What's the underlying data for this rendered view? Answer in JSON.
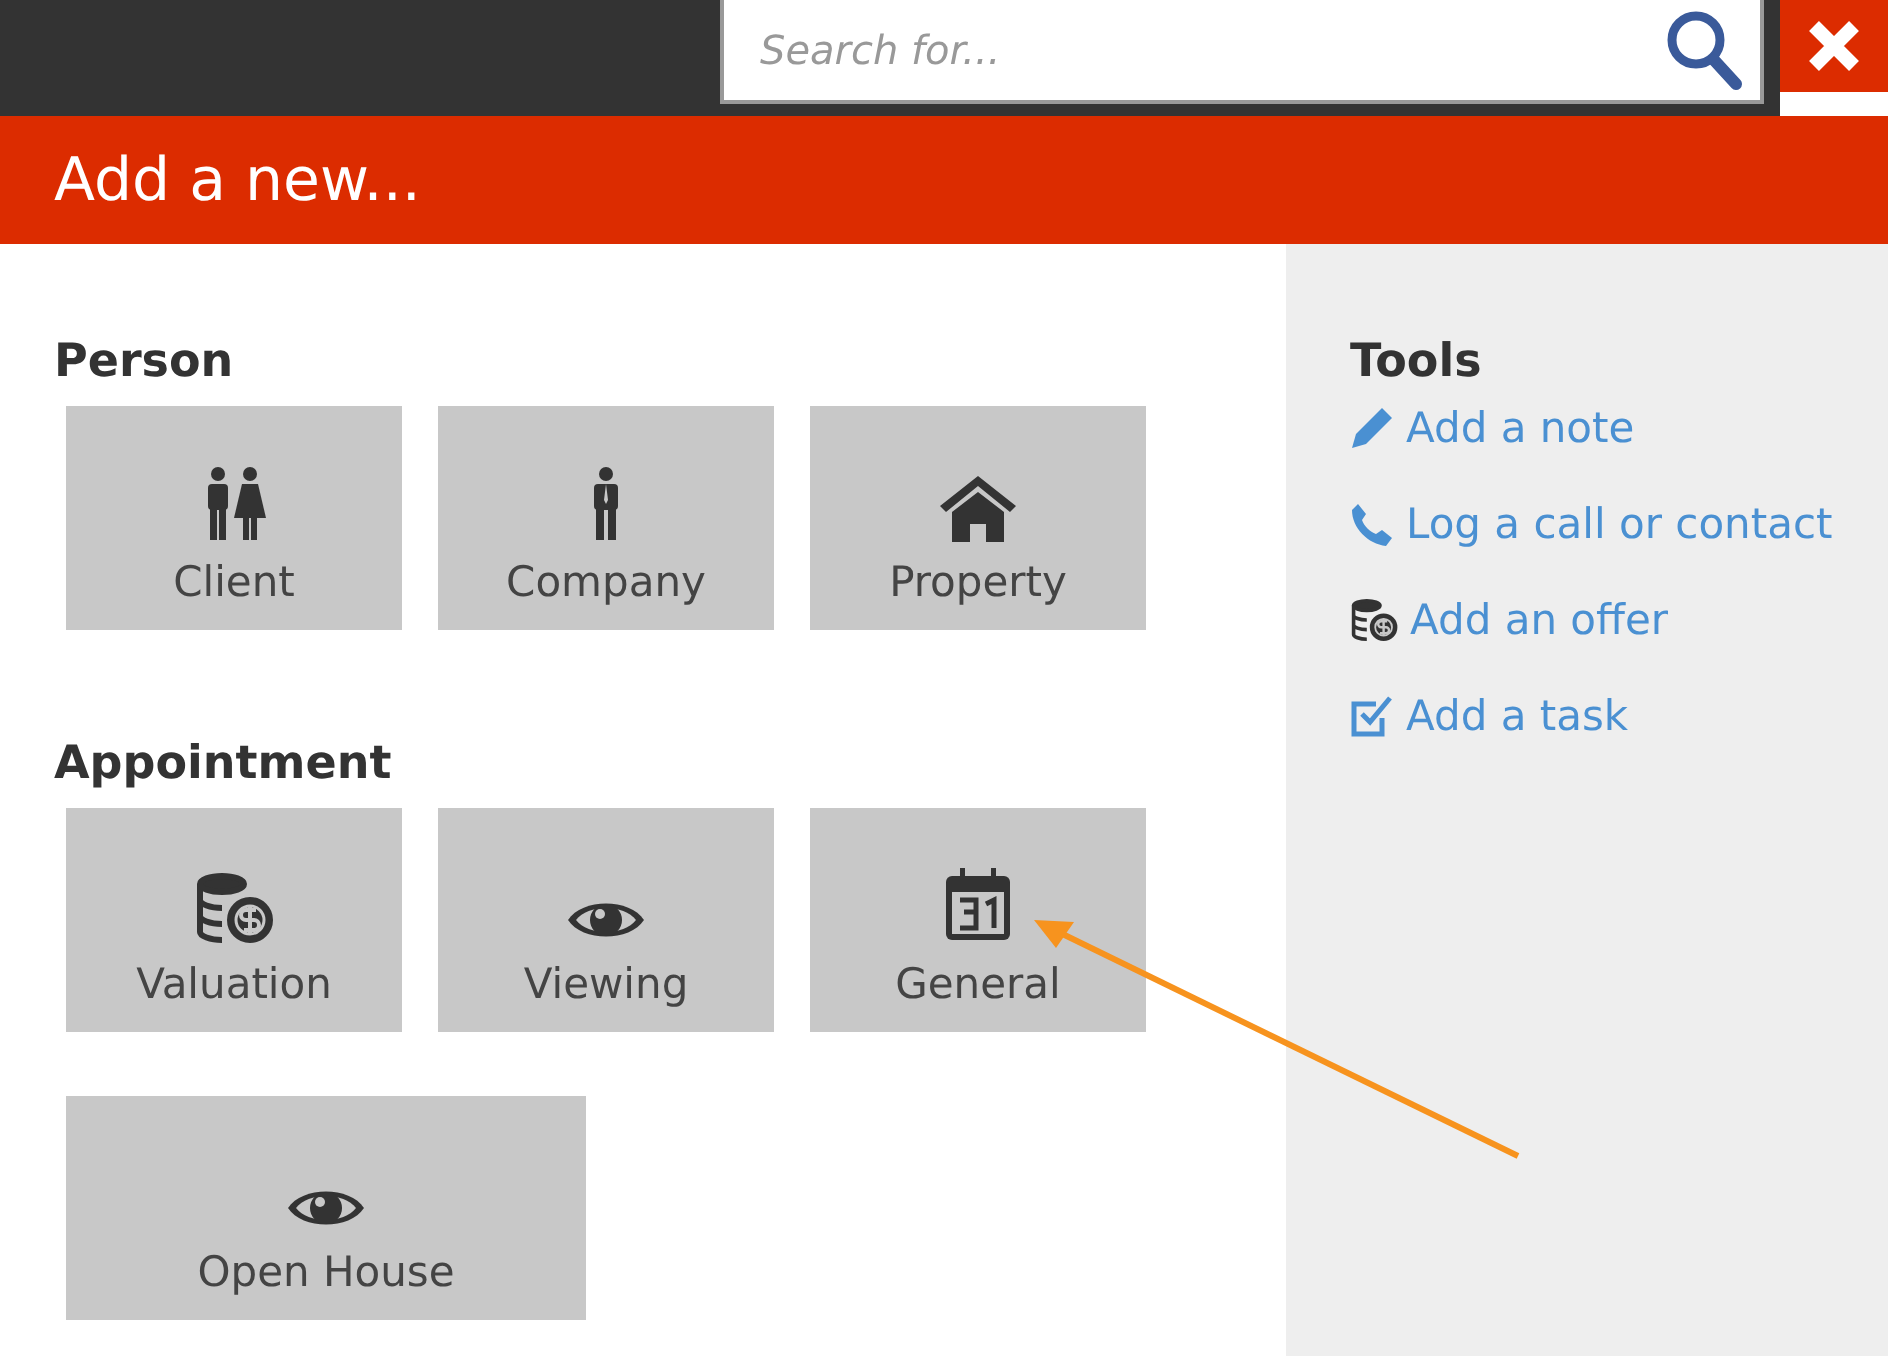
{
  "search": {
    "placeholder": "Search for..."
  },
  "header": {
    "title": "Add a new..."
  },
  "sections": [
    {
      "title": "Person",
      "tiles": [
        {
          "label": "Client",
          "wide": false
        },
        {
          "label": "Company",
          "wide": false
        },
        {
          "label": "Property",
          "wide": false
        }
      ]
    },
    {
      "title": "Appointment",
      "tiles": [
        {
          "label": "Valuation",
          "wide": false
        },
        {
          "label": "Viewing",
          "wide": false
        },
        {
          "label": "General",
          "wide": false
        },
        {
          "label": "Open House",
          "wide": true
        }
      ]
    }
  ],
  "tools": {
    "title": "Tools",
    "items": [
      {
        "label": "Add a note"
      },
      {
        "label": "Log a call or contact"
      },
      {
        "label": "Add an offer"
      },
      {
        "label": "Add a task"
      }
    ]
  }
}
